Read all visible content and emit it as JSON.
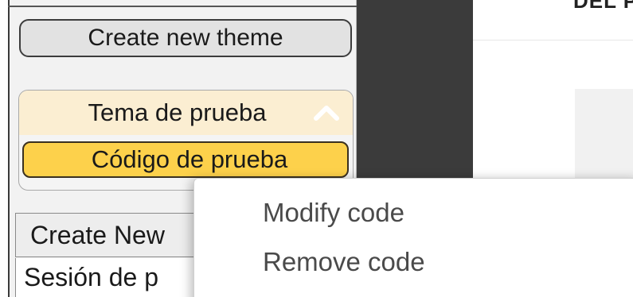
{
  "sidebar": {
    "create_theme_label": "Create new theme",
    "theme": {
      "title": "Tema de prueba",
      "expanded": true,
      "codes": [
        {
          "label": "Código de prueba",
          "selected": true
        }
      ]
    },
    "create_new_label": "Create New",
    "session_label": "Sesión de p"
  },
  "main": {
    "header_text": "DEL P"
  },
  "context_menu": {
    "items": [
      {
        "label": "Modify code"
      },
      {
        "label": "Remove code"
      }
    ]
  },
  "colors": {
    "theme_header_bg": "#fbeed2",
    "selected_code_bg": "#fdd14b",
    "dark_strip": "#3b3b3b"
  },
  "icons": {
    "theme_toggle": "chevron-up-icon"
  }
}
